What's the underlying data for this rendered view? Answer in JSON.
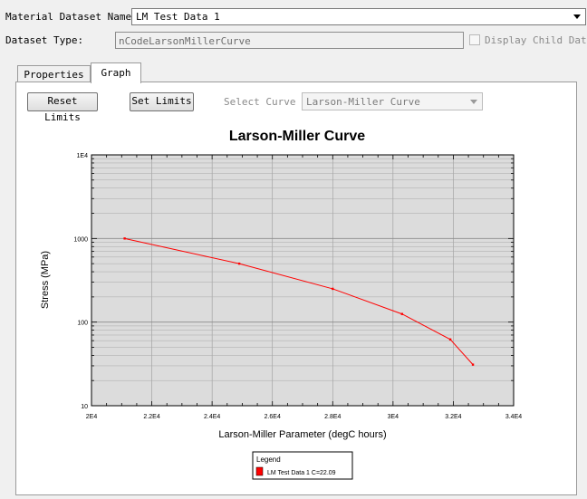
{
  "header": {
    "dataset_name_label": "Material Dataset Name:",
    "dataset_name_value": "LM Test Data 1",
    "dataset_type_label": "Dataset Type:",
    "dataset_type_value": "nCodeLarsonMillerCurve",
    "display_child_label": "Display Child Data",
    "display_child_checked": false
  },
  "tabs": [
    {
      "label": "Properties",
      "active": false
    },
    {
      "label": "Graph",
      "active": true
    }
  ],
  "toolbar": {
    "reset_label": "Reset Limits",
    "set_label": "Set Limits",
    "select_curve_label": "Select Curve",
    "select_curve_value": "Larson-Miller Curve"
  },
  "chart_data": {
    "type": "line",
    "title": "Larson-Miller Curve",
    "xlabel": "Larson-Miller Parameter (degC hours)",
    "ylabel": "Stress (MPa)",
    "xlim": [
      20000,
      34000
    ],
    "ylim": [
      10,
      10000
    ],
    "yscale": "log",
    "grid": true,
    "x_ticks": [
      {
        "value": 20000,
        "label": "2E4"
      },
      {
        "value": 22000,
        "label": "2.2E4"
      },
      {
        "value": 24000,
        "label": "2.4E4"
      },
      {
        "value": 26000,
        "label": "2.6E4"
      },
      {
        "value": 28000,
        "label": "2.8E4"
      },
      {
        "value": 30000,
        "label": "3E4"
      },
      {
        "value": 32000,
        "label": "3.2E4"
      },
      {
        "value": 34000,
        "label": "3.4E4"
      }
    ],
    "y_ticks": [
      {
        "value": 10,
        "label": "10"
      },
      {
        "value": 100,
        "label": "100"
      },
      {
        "value": 1000,
        "label": "1000"
      },
      {
        "value": 10000,
        "label": "1E4"
      }
    ],
    "series": [
      {
        "name": "LM Test Data 1  C=22.09",
        "color": "#ff0000",
        "x": [
          21100,
          24900,
          28000,
          30300,
          31900,
          32650
        ],
        "y": [
          1000,
          500,
          250,
          125,
          62,
          31
        ]
      }
    ],
    "legend": {
      "title": "Legend",
      "placement": "bottom-center"
    }
  },
  "colors": {
    "plot_background": "#dcdcdc",
    "series": "#ff0000"
  }
}
